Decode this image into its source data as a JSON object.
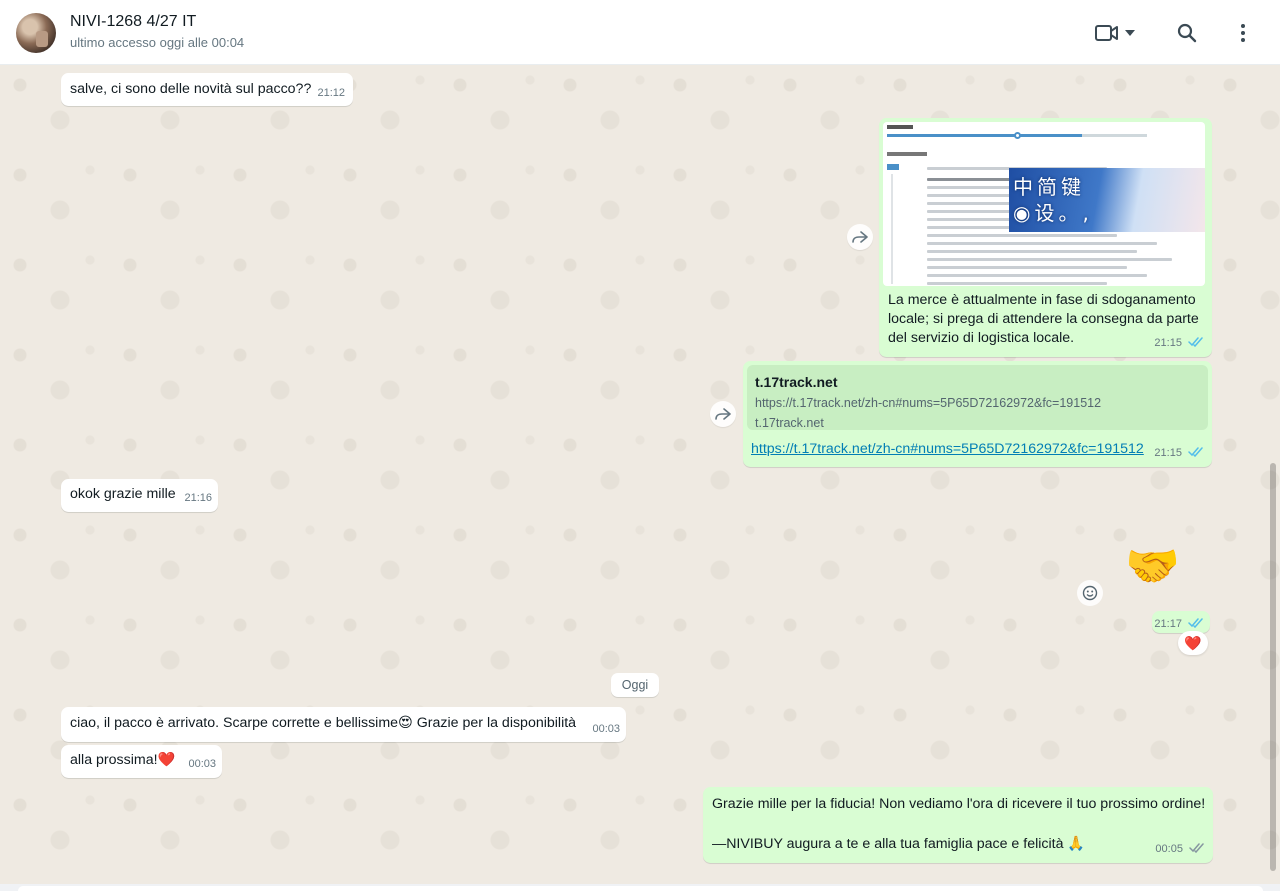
{
  "header": {
    "contact_name": "NIVI-1268 4/27 IT",
    "contact_status": "ultimo accesso oggi alle 00:04",
    "icons": [
      "video-call-icon",
      "chevron-down-icon",
      "search-icon",
      "menu-icon"
    ]
  },
  "messages": {
    "m1": {
      "text": "salve, ci sono delle novità sul pacco??",
      "time": "21:12",
      "direction": "in"
    },
    "m2": {
      "text": "La merce è attualmente in fase di sdoganamento locale; si prega di attendere la consegna da parte del servizio di logistica locale.",
      "time": "21:15",
      "direction": "out",
      "image_chars": "中简键\n◉设。,"
    },
    "m3": {
      "card_title": "t.17track.net",
      "card_url": "https://t.17track.net/zh-cn#nums=5P65D72162972&fc=191512",
      "card_domain": "t.17track.net",
      "link": "https://t.17track.net/zh-cn#nums=5P65D72162972&fc=191512",
      "time": "21:15",
      "direction": "out"
    },
    "m4": {
      "text": "okok grazie mille",
      "time": "21:16",
      "direction": "in"
    },
    "m5": {
      "sticker": "🤝",
      "time": "21:17",
      "direction": "out",
      "reaction": "❤️"
    },
    "date_divider": "Oggi",
    "m6": {
      "text": "ciao, il pacco è arrivato. Scarpe corrette e bellissime😍 Grazie per la disponibilità",
      "time": "00:03",
      "direction": "in"
    },
    "m7": {
      "text": "alla prossima!❤️",
      "time": "00:03",
      "direction": "in"
    },
    "m8": {
      "line1": "Grazie mille per la fiducia! Non vediamo l'ora di ricevere il tuo prossimo ordine!",
      "line2": "—NIVIBUY augura a te e alla tua famiglia pace e felicità 🙏",
      "time": "00:05",
      "direction": "out"
    }
  },
  "colors": {
    "chat_bg": "#efeae2",
    "incoming_bubble": "#ffffff",
    "outgoing_bubble": "#d9fdd3",
    "link": "#027eb5",
    "read_ticks": "#53bdeb"
  }
}
